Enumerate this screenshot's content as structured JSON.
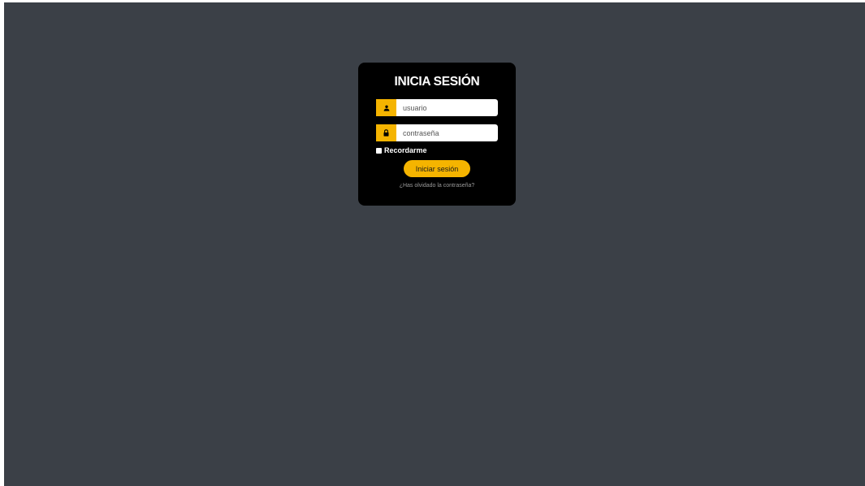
{
  "login": {
    "title": "INICIA SESIÓN",
    "username": {
      "placeholder": "usuario",
      "icon": "user-icon",
      "value": ""
    },
    "password": {
      "placeholder": "contraseña",
      "icon": "lock-icon",
      "value": ""
    },
    "remember_label": "Recordarme",
    "remember_checked": false,
    "submit_label": "Iniciar sesión",
    "forgot_label": "¿Has olvidado la contraseña?"
  },
  "colors": {
    "background": "#3b4047",
    "card": "#000000",
    "accent": "#f5b400",
    "title": "#ffffff",
    "muted_link": "#9a9a9a"
  }
}
